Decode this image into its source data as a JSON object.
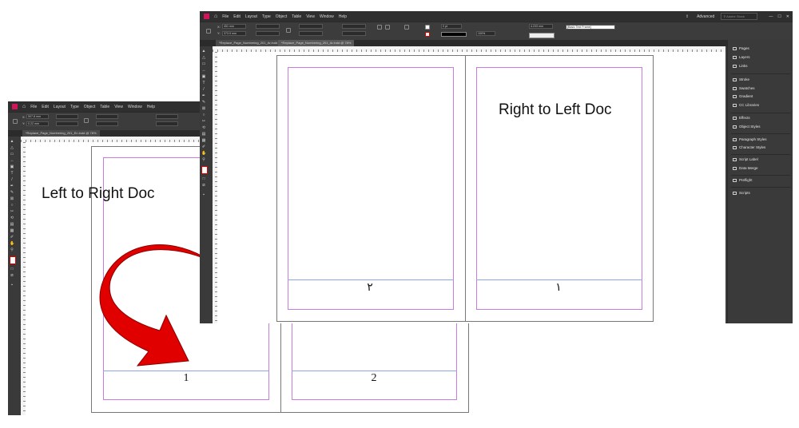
{
  "menu": [
    "File",
    "Edit",
    "Layout",
    "Type",
    "Object",
    "Table",
    "View",
    "Window",
    "Help"
  ],
  "back_window": {
    "tab_title": "*Replace_Page_Numbering_201_En.indd @ 78%",
    "ref_x": "507.8 mm",
    "ref_y": "0.22 mm",
    "doc_label": "Left  to Right Doc",
    "page_numbers": [
      "1",
      "2"
    ]
  },
  "front_window": {
    "tab_title": "*Replace_Page_Numbering_201_Ar.indd @ 78%",
    "ref_x": "451 mm",
    "ref_y": "373.9 mm",
    "workspace": "Advanced",
    "search_placeholder": "Adobe Stock",
    "stroke_weight": "0 pt",
    "zoom": "100%",
    "gap": "4.233 mm",
    "frame_style": "[Basic Text Frame]",
    "doc_label": "Right to Left Doc",
    "page_numbers": [
      "٢",
      "١"
    ]
  },
  "panels": [
    {
      "label": "Pages",
      "icon": "pages-icon"
    },
    {
      "label": "Layers",
      "icon": "layers-icon"
    },
    {
      "label": "Links",
      "icon": "links-icon"
    },
    {
      "label": "Stroke",
      "icon": "stroke-icon"
    },
    {
      "label": "Swatches",
      "icon": "swatches-icon"
    },
    {
      "label": "Gradient",
      "icon": "gradient-icon"
    },
    {
      "label": "CC Libraries",
      "icon": "cc-libraries-icon"
    },
    {
      "label": "Effects",
      "icon": "effects-icon"
    },
    {
      "label": "Object Styles",
      "icon": "object-styles-icon"
    },
    {
      "label": "Paragraph Styles",
      "icon": "paragraph-styles-icon"
    },
    {
      "label": "Character Styles",
      "icon": "character-styles-icon"
    },
    {
      "label": "Script Label",
      "icon": "script-label-icon"
    },
    {
      "label": "Data Merge",
      "icon": "data-merge-icon"
    },
    {
      "label": "Preflight",
      "icon": "preflight-icon"
    },
    {
      "label": "Scripts",
      "icon": "scripts-icon"
    }
  ],
  "colors": {
    "arrow": "#e00000",
    "margin_guide": "#c77ce0",
    "accent": "#d4145a"
  }
}
